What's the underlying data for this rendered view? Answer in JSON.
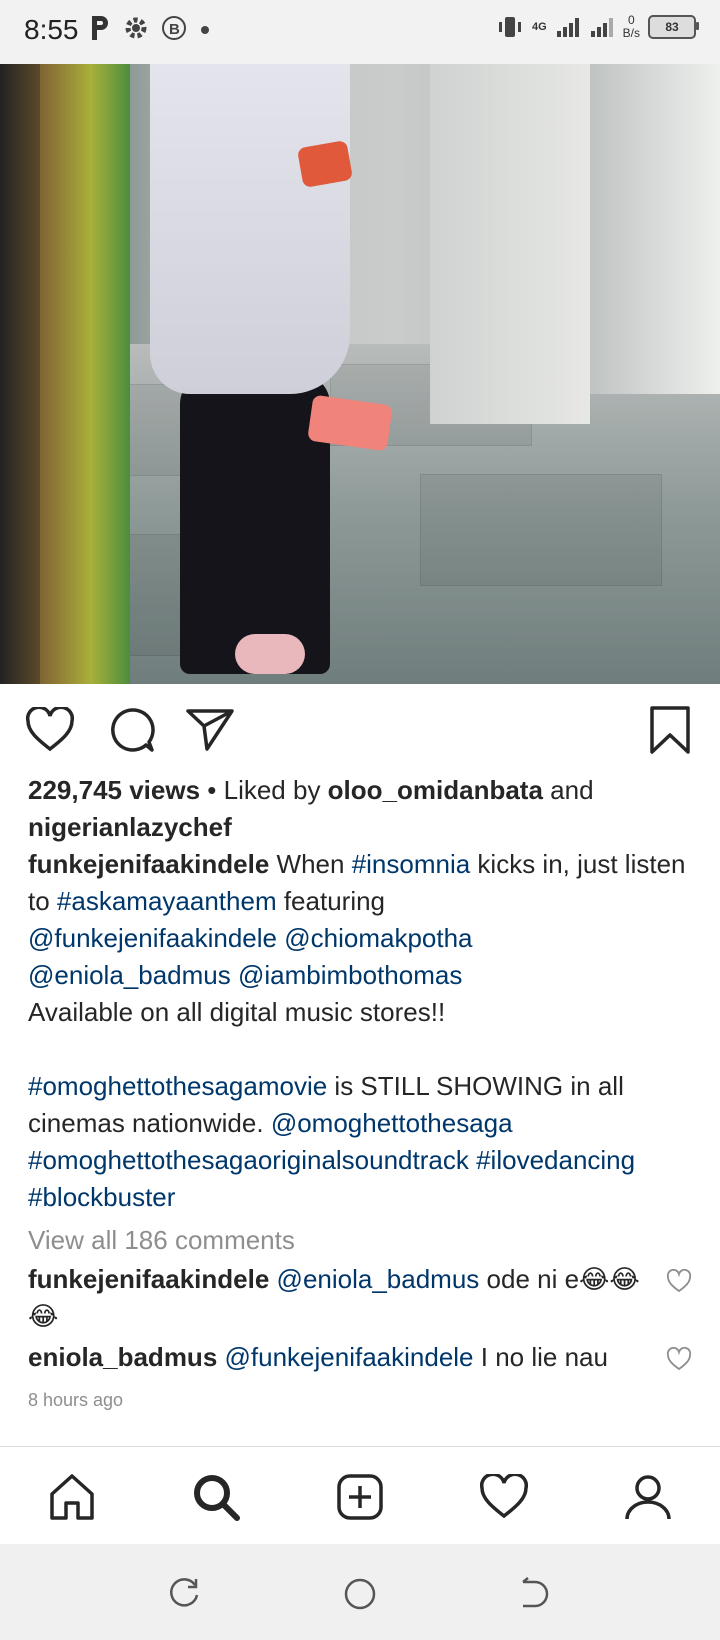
{
  "status_bar": {
    "time": "8:55",
    "network_label": "4G",
    "speed_value": "0",
    "speed_unit": "B/s",
    "battery": "83",
    "icons": [
      "parking-icon",
      "settings-icon",
      "b-circle-icon",
      "dot-icon",
      "vibrate-icon",
      "signal-icon",
      "wifi-signal-icon"
    ]
  },
  "post": {
    "views": "229,745 views",
    "liked_by_prefix": "• Liked by ",
    "liker_1": "oloo_omidanbata",
    "and_text": " and",
    "liker_2": "nigerianlazychef",
    "caption": {
      "username": "funkejenifaakindele",
      "t1": " When ",
      "tag_insomnia": "#insomnia",
      "t2": " kicks in, just listen to ",
      "tag_anthem": "#askamayaanthem",
      "t3": " featuring",
      "m1": "@funkejenifaakindele",
      "m2": "@chiomakpotha",
      "m3": "@eniola_badmus",
      "m4": "@iambimbothomas",
      "t4": "Available on all digital music stores!!",
      "tag_movie": "#omoghettothesagamovie",
      "t5": " is STILL SHOWING in all cinemas nationwide. ",
      "m5": "@omoghettothesaga",
      "tag_soundtrack": "#omoghettothesagaoriginalsoundtrack",
      "tag_dancing": "#ilovedancing",
      "tag_blockbuster": "#blockbuster"
    },
    "view_comments": "View all 186 comments",
    "comments": [
      {
        "username": "funkejenifaakindele",
        "mention": "@eniola_badmus",
        "text": " ode ni e😂😂😂"
      },
      {
        "username": "eniola_badmus",
        "mention": "@funkejenifaakindele",
        "text": " I no lie nau"
      }
    ],
    "timestamp": "8 hours ago"
  },
  "colors": {
    "link": "#00376b",
    "muted": "#8e8e8e",
    "text": "#262626"
  },
  "bottom_nav": [
    "home-icon",
    "search-icon",
    "add-post-icon",
    "activity-heart-icon",
    "profile-icon"
  ],
  "system_nav": [
    "recent-apps-icon",
    "home-circle-icon",
    "back-icon"
  ]
}
